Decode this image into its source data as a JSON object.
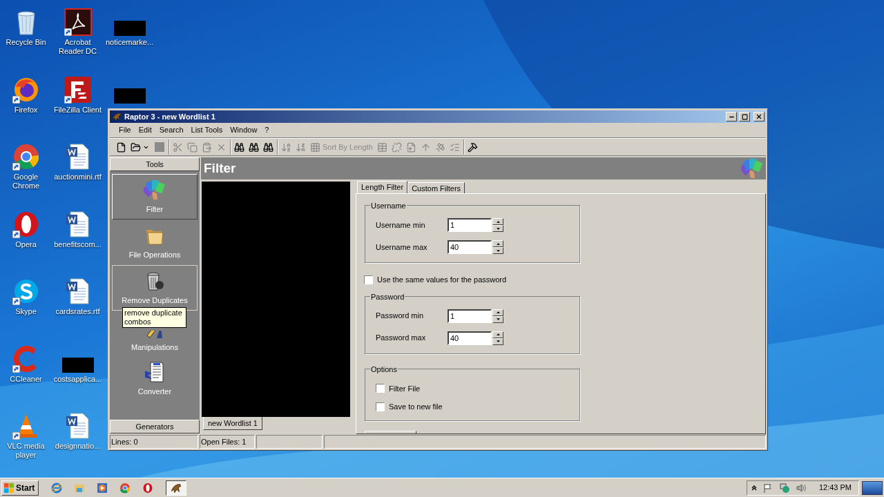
{
  "desktop": {
    "columns": [
      [
        {
          "label": "Recycle Bin",
          "kind": "recycle-bin",
          "shortcut": false
        },
        {
          "label": "Firefox",
          "kind": "firefox",
          "shortcut": true
        },
        {
          "label": "Google Chrome",
          "kind": "chrome",
          "shortcut": true
        },
        {
          "label": "Opera",
          "kind": "opera",
          "shortcut": true
        },
        {
          "label": "Skype",
          "kind": "skype",
          "shortcut": true
        },
        {
          "label": "CCleaner",
          "kind": "ccleaner",
          "shortcut": true
        },
        {
          "label": "VLC media player",
          "kind": "vlc",
          "shortcut": true
        }
      ],
      [
        {
          "label": "Acrobat Reader DC",
          "kind": "acrobat",
          "shortcut": true
        },
        {
          "label": "FileZilla Client",
          "kind": "filezilla",
          "shortcut": true
        },
        {
          "label": "auctionmini.rtf",
          "kind": "word-doc",
          "shortcut": false
        },
        {
          "label": "benefitscom...",
          "kind": "word-doc",
          "shortcut": false
        },
        {
          "label": "cardsrates.rtf",
          "kind": "word-doc",
          "shortcut": false
        },
        {
          "label": "costsapplica...",
          "kind": "redacted",
          "shortcut": false
        },
        {
          "label": "designnatio...",
          "kind": "word-doc",
          "shortcut": false
        }
      ],
      [
        {
          "label": "noticemarke...",
          "kind": "redacted",
          "shortcut": false
        },
        {
          "kind": "redacted",
          "shortcut": false
        }
      ]
    ]
  },
  "window": {
    "title": "Raptor 3 - new Wordlist 1",
    "menu": [
      "File",
      "Edit",
      "Search",
      "List Tools",
      "Window",
      "?"
    ],
    "toolbar": [
      [
        {
          "kind": "new",
          "disabled": false
        },
        {
          "kind": "open",
          "disabled": false
        },
        {
          "kind": "stop",
          "disabled": true
        }
      ],
      [
        {
          "kind": "cut",
          "disabled": true
        },
        {
          "kind": "copy",
          "disabled": true
        },
        {
          "kind": "paste",
          "disabled": true
        },
        {
          "kind": "delete",
          "disabled": true
        }
      ],
      [
        {
          "kind": "find",
          "disabled": false
        },
        {
          "kind": "find-next",
          "disabled": false
        },
        {
          "kind": "find-replace",
          "disabled": false
        }
      ],
      [
        {
          "kind": "sort-az",
          "disabled": true
        },
        {
          "kind": "sort-za",
          "disabled": true
        },
        {
          "kind": "sort-length",
          "label": "Sort By Length",
          "disabled": true
        },
        {
          "kind": "table",
          "disabled": true
        },
        {
          "kind": "unlink",
          "disabled": true
        },
        {
          "kind": "move",
          "disabled": true
        },
        {
          "kind": "up",
          "disabled": true
        },
        {
          "kind": "antenna",
          "disabled": true
        },
        {
          "kind": "list-edit",
          "disabled": true
        }
      ],
      [
        {
          "kind": "tools",
          "disabled": false
        }
      ]
    ],
    "tools_panel": {
      "header": "Tools",
      "items": [
        {
          "label": "Filter",
          "kind": "filter",
          "selected": true,
          "hovered": false
        },
        {
          "label": "File Operations",
          "kind": "folder",
          "selected": false,
          "hovered": false
        },
        {
          "label": "Remove Duplicates",
          "kind": "trash",
          "selected": false,
          "hovered": true
        },
        {
          "label": "Manipulations",
          "kind": "pencil",
          "selected": false,
          "hovered": false
        },
        {
          "label": "Converter",
          "kind": "converter",
          "selected": false,
          "hovered": false
        }
      ],
      "footer": "Generators",
      "tooltip": "remove duplicate combos"
    },
    "panel_title": "Filter",
    "document_tabs": [
      {
        "label": "new Wordlist 1",
        "selected": true
      }
    ],
    "filter_tabs": [
      {
        "label": "Length Filter",
        "selected": true
      },
      {
        "label": "Custom Filters",
        "selected": false
      }
    ],
    "username": {
      "legend": "Username",
      "fields": [
        {
          "label": "Username min",
          "value": "1"
        },
        {
          "label": "Username max",
          "value": "40"
        }
      ]
    },
    "same_values": {
      "label": "Use the same values for the password",
      "checked": false
    },
    "password": {
      "legend": "Password",
      "fields": [
        {
          "label": "Password min",
          "value": "1"
        },
        {
          "label": "Password max",
          "value": "40"
        }
      ]
    },
    "options": {
      "legend": "Options",
      "items": [
        {
          "label": "Filter File",
          "checked": false
        },
        {
          "label": "Save to new file",
          "checked": false
        }
      ]
    },
    "status_bar": [
      "Lines: 0",
      "Open Files: 1"
    ]
  },
  "taskbar": {
    "start": "Start",
    "quick_launch": [
      {
        "kind": "ie"
      },
      {
        "kind": "explorer"
      },
      {
        "kind": "media"
      },
      {
        "kind": "chrome"
      },
      {
        "kind": "opera"
      }
    ],
    "tasks": [
      {
        "kind": "raptor",
        "selected": true
      }
    ],
    "clock": "12:43 PM"
  }
}
